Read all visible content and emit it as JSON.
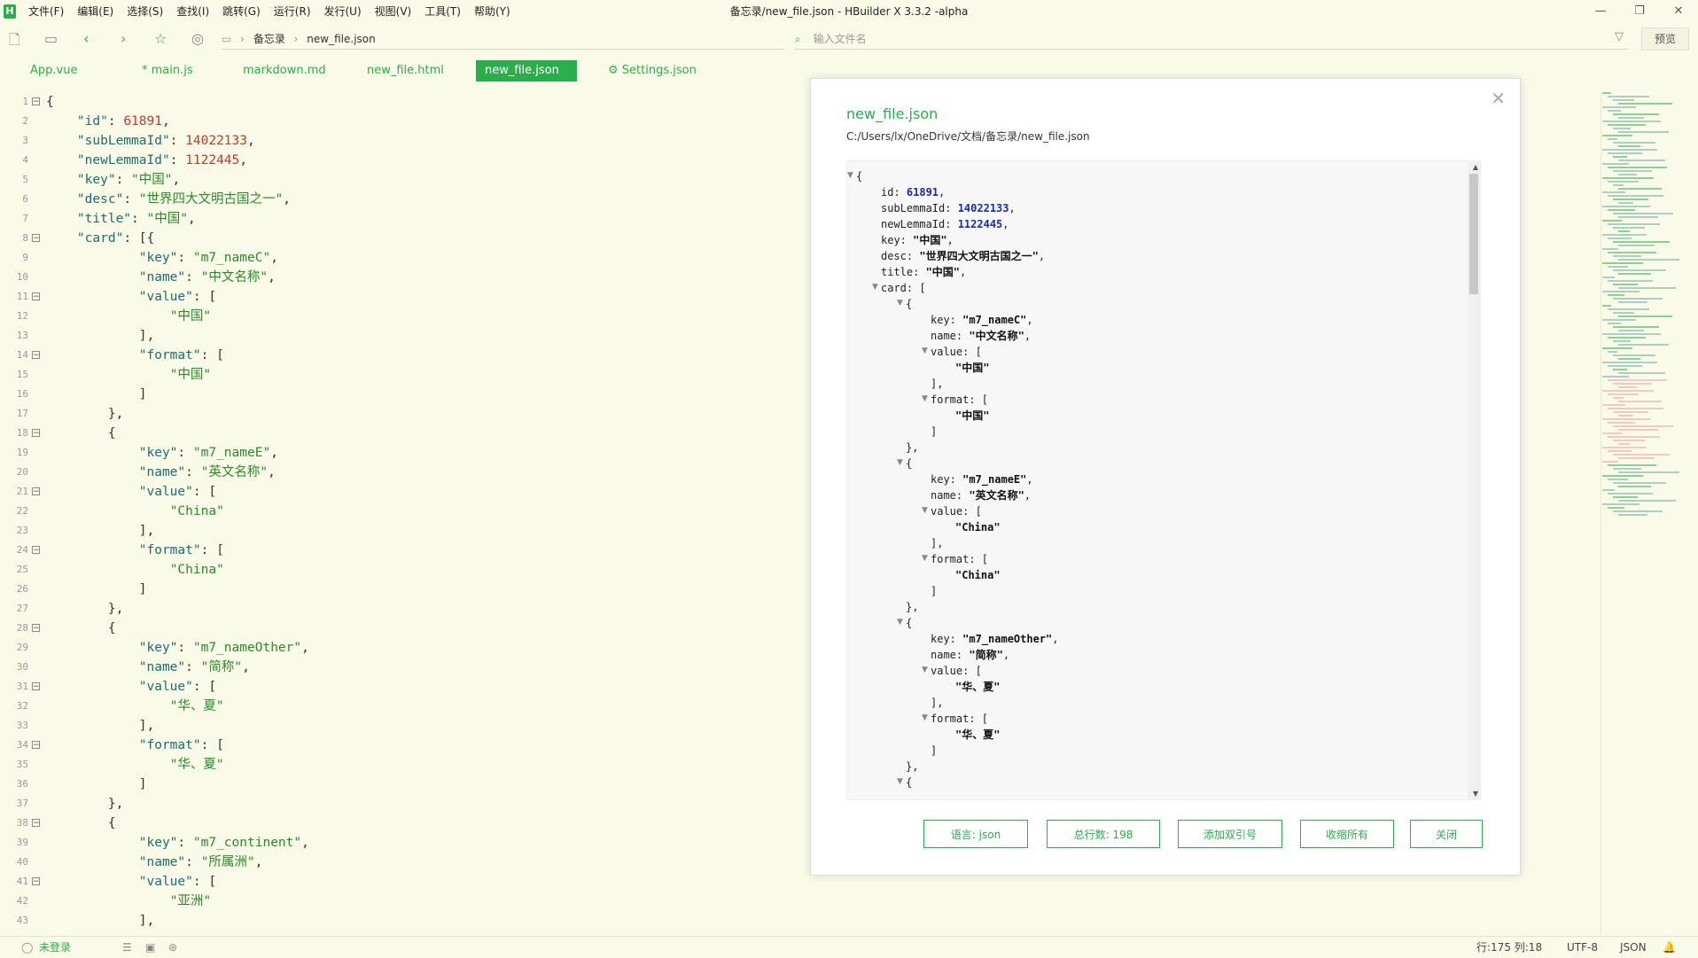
{
  "titlebar": {
    "menu": [
      "文件(F)",
      "编辑(E)",
      "选择(S)",
      "查找(I)",
      "跳转(G)",
      "运行(R)",
      "发行(U)",
      "视图(V)",
      "工具(T)",
      "帮助(Y)"
    ],
    "window_title": "备忘录/new_file.json - HBuilder X 3.3.2 -alpha"
  },
  "toolbar": {
    "breadcrumb": [
      "备忘录",
      "new_file.json"
    ],
    "file_search_placeholder": "输入文件名",
    "preview_label": "预览"
  },
  "tabs": [
    {
      "label": "App.vue",
      "active": false
    },
    {
      "label": "* main.js",
      "active": false
    },
    {
      "label": "markdown.md",
      "active": false
    },
    {
      "label": "new_file.html",
      "active": false
    },
    {
      "label": "new_file.json",
      "active": true
    },
    {
      "label": "⚙ Settings.json",
      "active": false
    }
  ],
  "editor_lines": [
    {
      "n": "1",
      "fold": true,
      "tokens": [
        [
          "p",
          "{"
        ]
      ]
    },
    {
      "n": "2",
      "tokens": [
        [
          "p",
          "    "
        ],
        [
          "k",
          "\"id\""
        ],
        [
          "p",
          ": "
        ],
        [
          "n",
          "61891"
        ],
        [
          "p",
          ","
        ]
      ]
    },
    {
      "n": "3",
      "tokens": [
        [
          "p",
          "    "
        ],
        [
          "k",
          "\"subLemmaId\""
        ],
        [
          "p",
          ": "
        ],
        [
          "n",
          "14022133"
        ],
        [
          "p",
          ","
        ]
      ]
    },
    {
      "n": "4",
      "tokens": [
        [
          "p",
          "    "
        ],
        [
          "k",
          "\"newLemmaId\""
        ],
        [
          "p",
          ": "
        ],
        [
          "n",
          "1122445"
        ],
        [
          "p",
          ","
        ]
      ]
    },
    {
      "n": "5",
      "tokens": [
        [
          "p",
          "    "
        ],
        [
          "k",
          "\"key\""
        ],
        [
          "p",
          ": "
        ],
        [
          "s",
          "\"中国\""
        ],
        [
          "p",
          ","
        ]
      ]
    },
    {
      "n": "6",
      "tokens": [
        [
          "p",
          "    "
        ],
        [
          "k",
          "\"desc\""
        ],
        [
          "p",
          ": "
        ],
        [
          "s",
          "\"世界四大文明古国之一\""
        ],
        [
          "p",
          ","
        ]
      ]
    },
    {
      "n": "7",
      "tokens": [
        [
          "p",
          "    "
        ],
        [
          "k",
          "\"title\""
        ],
        [
          "p",
          ": "
        ],
        [
          "s",
          "\"中国\""
        ],
        [
          "p",
          ","
        ]
      ]
    },
    {
      "n": "8",
      "fold": true,
      "tokens": [
        [
          "p",
          "    "
        ],
        [
          "k",
          "\"card\""
        ],
        [
          "p",
          ": [{"
        ]
      ]
    },
    {
      "n": "9",
      "tokens": [
        [
          "p",
          "            "
        ],
        [
          "k",
          "\"key\""
        ],
        [
          "p",
          ": "
        ],
        [
          "s",
          "\"m7_nameC\""
        ],
        [
          "p",
          ","
        ]
      ]
    },
    {
      "n": "10",
      "tokens": [
        [
          "p",
          "            "
        ],
        [
          "k",
          "\"name\""
        ],
        [
          "p",
          ": "
        ],
        [
          "s",
          "\"中文名称\""
        ],
        [
          "p",
          ","
        ]
      ]
    },
    {
      "n": "11",
      "fold": true,
      "tokens": [
        [
          "p",
          "            "
        ],
        [
          "k",
          "\"value\""
        ],
        [
          "p",
          ": ["
        ]
      ]
    },
    {
      "n": "12",
      "tokens": [
        [
          "p",
          "                "
        ],
        [
          "s",
          "\"中国\""
        ]
      ]
    },
    {
      "n": "13",
      "tokens": [
        [
          "p",
          "            ],"
        ]
      ]
    },
    {
      "n": "14",
      "fold": true,
      "tokens": [
        [
          "p",
          "            "
        ],
        [
          "k",
          "\"format\""
        ],
        [
          "p",
          ": ["
        ]
      ]
    },
    {
      "n": "15",
      "tokens": [
        [
          "p",
          "                "
        ],
        [
          "s",
          "\"中国\""
        ]
      ]
    },
    {
      "n": "16",
      "tokens": [
        [
          "p",
          "            ]"
        ]
      ]
    },
    {
      "n": "17",
      "tokens": [
        [
          "p",
          "        },"
        ]
      ]
    },
    {
      "n": "18",
      "fold": true,
      "tokens": [
        [
          "p",
          "        {"
        ]
      ]
    },
    {
      "n": "19",
      "tokens": [
        [
          "p",
          "            "
        ],
        [
          "k",
          "\"key\""
        ],
        [
          "p",
          ": "
        ],
        [
          "s",
          "\"m7_nameE\""
        ],
        [
          "p",
          ","
        ]
      ]
    },
    {
      "n": "20",
      "tokens": [
        [
          "p",
          "            "
        ],
        [
          "k",
          "\"name\""
        ],
        [
          "p",
          ": "
        ],
        [
          "s",
          "\"英文名称\""
        ],
        [
          "p",
          ","
        ]
      ]
    },
    {
      "n": "21",
      "fold": true,
      "tokens": [
        [
          "p",
          "            "
        ],
        [
          "k",
          "\"value\""
        ],
        [
          "p",
          ": ["
        ]
      ]
    },
    {
      "n": "22",
      "tokens": [
        [
          "p",
          "                "
        ],
        [
          "s",
          "\"China\""
        ]
      ]
    },
    {
      "n": "23",
      "tokens": [
        [
          "p",
          "            ],"
        ]
      ]
    },
    {
      "n": "24",
      "fold": true,
      "tokens": [
        [
          "p",
          "            "
        ],
        [
          "k",
          "\"format\""
        ],
        [
          "p",
          ": ["
        ]
      ]
    },
    {
      "n": "25",
      "tokens": [
        [
          "p",
          "                "
        ],
        [
          "s",
          "\"China\""
        ]
      ]
    },
    {
      "n": "26",
      "tokens": [
        [
          "p",
          "            ]"
        ]
      ]
    },
    {
      "n": "27",
      "tokens": [
        [
          "p",
          "        },"
        ]
      ]
    },
    {
      "n": "28",
      "fold": true,
      "tokens": [
        [
          "p",
          "        {"
        ]
      ]
    },
    {
      "n": "29",
      "tokens": [
        [
          "p",
          "            "
        ],
        [
          "k",
          "\"key\""
        ],
        [
          "p",
          ": "
        ],
        [
          "s",
          "\"m7_nameOther\""
        ],
        [
          "p",
          ","
        ]
      ]
    },
    {
      "n": "30",
      "tokens": [
        [
          "p",
          "            "
        ],
        [
          "k",
          "\"name\""
        ],
        [
          "p",
          ": "
        ],
        [
          "s",
          "\"简称\""
        ],
        [
          "p",
          ","
        ]
      ]
    },
    {
      "n": "31",
      "fold": true,
      "tokens": [
        [
          "p",
          "            "
        ],
        [
          "k",
          "\"value\""
        ],
        [
          "p",
          ": ["
        ]
      ]
    },
    {
      "n": "32",
      "tokens": [
        [
          "p",
          "                "
        ],
        [
          "s",
          "\"华、夏\""
        ]
      ]
    },
    {
      "n": "33",
      "tokens": [
        [
          "p",
          "            ],"
        ]
      ]
    },
    {
      "n": "34",
      "fold": true,
      "tokens": [
        [
          "p",
          "            "
        ],
        [
          "k",
          "\"format\""
        ],
        [
          "p",
          ": ["
        ]
      ]
    },
    {
      "n": "35",
      "tokens": [
        [
          "p",
          "                "
        ],
        [
          "s",
          "\"华、夏\""
        ]
      ]
    },
    {
      "n": "36",
      "tokens": [
        [
          "p",
          "            ]"
        ]
      ]
    },
    {
      "n": "37",
      "tokens": [
        [
          "p",
          "        },"
        ]
      ]
    },
    {
      "n": "38",
      "fold": true,
      "tokens": [
        [
          "p",
          "        {"
        ]
      ]
    },
    {
      "n": "39",
      "tokens": [
        [
          "p",
          "            "
        ],
        [
          "k",
          "\"key\""
        ],
        [
          "p",
          ": "
        ],
        [
          "s",
          "\"m7_continent\""
        ],
        [
          "p",
          ","
        ]
      ]
    },
    {
      "n": "40",
      "tokens": [
        [
          "p",
          "            "
        ],
        [
          "k",
          "\"name\""
        ],
        [
          "p",
          ": "
        ],
        [
          "s",
          "\"所属洲\""
        ],
        [
          "p",
          ","
        ]
      ]
    },
    {
      "n": "41",
      "fold": true,
      "tokens": [
        [
          "p",
          "            "
        ],
        [
          "k",
          "\"value\""
        ],
        [
          "p",
          ": ["
        ]
      ]
    },
    {
      "n": "42",
      "tokens": [
        [
          "p",
          "                "
        ],
        [
          "s",
          "\"亚洲\""
        ]
      ]
    },
    {
      "n": "43",
      "tokens": [
        [
          "p",
          "            ],"
        ]
      ]
    }
  ],
  "dialog": {
    "title": "new_file.json",
    "path": "C:/Users/lx/OneDrive/文档/备忘录/new_file.json",
    "tree_lines": [
      {
        "indent": 0,
        "tri": true,
        "tokens": [
          [
            "p",
            "{"
          ]
        ]
      },
      {
        "indent": 2,
        "tokens": [
          [
            "k",
            "id: "
          ],
          [
            "n",
            "61891"
          ],
          [
            "p",
            ","
          ]
        ]
      },
      {
        "indent": 2,
        "tokens": [
          [
            "k",
            "subLemmaId: "
          ],
          [
            "n",
            "14022133"
          ],
          [
            "p",
            ","
          ]
        ]
      },
      {
        "indent": 2,
        "tokens": [
          [
            "k",
            "newLemmaId: "
          ],
          [
            "n",
            "1122445"
          ],
          [
            "p",
            ","
          ]
        ]
      },
      {
        "indent": 2,
        "tokens": [
          [
            "k",
            "key: "
          ],
          [
            "s",
            "\"中国\""
          ],
          [
            "p",
            ","
          ]
        ]
      },
      {
        "indent": 2,
        "tokens": [
          [
            "k",
            "desc: "
          ],
          [
            "s",
            "\"世界四大文明古国之一\""
          ],
          [
            "p",
            ","
          ]
        ]
      },
      {
        "indent": 2,
        "tokens": [
          [
            "k",
            "title: "
          ],
          [
            "s",
            "\"中国\""
          ],
          [
            "p",
            ","
          ]
        ]
      },
      {
        "indent": 2,
        "tri": true,
        "tokens": [
          [
            "k",
            "card: "
          ],
          [
            "p",
            "["
          ]
        ]
      },
      {
        "indent": 4,
        "tri": true,
        "tokens": [
          [
            "p",
            "{"
          ]
        ]
      },
      {
        "indent": 6,
        "tokens": [
          [
            "k",
            "key: "
          ],
          [
            "s",
            "\"m7_nameC\""
          ],
          [
            "p",
            ","
          ]
        ]
      },
      {
        "indent": 6,
        "tokens": [
          [
            "k",
            "name: "
          ],
          [
            "s",
            "\"中文名称\""
          ],
          [
            "p",
            ","
          ]
        ]
      },
      {
        "indent": 6,
        "tri": true,
        "tokens": [
          [
            "k",
            "value: "
          ],
          [
            "p",
            "["
          ]
        ]
      },
      {
        "indent": 8,
        "tokens": [
          [
            "s",
            "\"中国\""
          ]
        ]
      },
      {
        "indent": 6,
        "tokens": [
          [
            "p",
            "],"
          ]
        ]
      },
      {
        "indent": 6,
        "tri": true,
        "tokens": [
          [
            "k",
            "format: "
          ],
          [
            "p",
            "["
          ]
        ]
      },
      {
        "indent": 8,
        "tokens": [
          [
            "s",
            "\"中国\""
          ]
        ]
      },
      {
        "indent": 6,
        "tokens": [
          [
            "p",
            "]"
          ]
        ]
      },
      {
        "indent": 4,
        "tokens": [
          [
            "p",
            "},"
          ]
        ]
      },
      {
        "indent": 4,
        "tri": true,
        "tokens": [
          [
            "p",
            "{"
          ]
        ]
      },
      {
        "indent": 6,
        "tokens": [
          [
            "k",
            "key: "
          ],
          [
            "s",
            "\"m7_nameE\""
          ],
          [
            "p",
            ","
          ]
        ]
      },
      {
        "indent": 6,
        "tokens": [
          [
            "k",
            "name: "
          ],
          [
            "s",
            "\"英文名称\""
          ],
          [
            "p",
            ","
          ]
        ]
      },
      {
        "indent": 6,
        "tri": true,
        "tokens": [
          [
            "k",
            "value: "
          ],
          [
            "p",
            "["
          ]
        ]
      },
      {
        "indent": 8,
        "tokens": [
          [
            "s",
            "\"China\""
          ]
        ]
      },
      {
        "indent": 6,
        "tokens": [
          [
            "p",
            "],"
          ]
        ]
      },
      {
        "indent": 6,
        "tri": true,
        "tokens": [
          [
            "k",
            "format: "
          ],
          [
            "p",
            "["
          ]
        ]
      },
      {
        "indent": 8,
        "tokens": [
          [
            "s",
            "\"China\""
          ]
        ]
      },
      {
        "indent": 6,
        "tokens": [
          [
            "p",
            "]"
          ]
        ]
      },
      {
        "indent": 4,
        "tokens": [
          [
            "p",
            "},"
          ]
        ]
      },
      {
        "indent": 4,
        "tri": true,
        "tokens": [
          [
            "p",
            "{"
          ]
        ]
      },
      {
        "indent": 6,
        "tokens": [
          [
            "k",
            "key: "
          ],
          [
            "s",
            "\"m7_nameOther\""
          ],
          [
            "p",
            ","
          ]
        ]
      },
      {
        "indent": 6,
        "tokens": [
          [
            "k",
            "name: "
          ],
          [
            "s",
            "\"简称\""
          ],
          [
            "p",
            ","
          ]
        ]
      },
      {
        "indent": 6,
        "tri": true,
        "tokens": [
          [
            "k",
            "value: "
          ],
          [
            "p",
            "["
          ]
        ]
      },
      {
        "indent": 8,
        "tokens": [
          [
            "s",
            "\"华、夏\""
          ]
        ]
      },
      {
        "indent": 6,
        "tokens": [
          [
            "p",
            "],"
          ]
        ]
      },
      {
        "indent": 6,
        "tri": true,
        "tokens": [
          [
            "k",
            "format: "
          ],
          [
            "p",
            "["
          ]
        ]
      },
      {
        "indent": 8,
        "tokens": [
          [
            "s",
            "\"华、夏\""
          ]
        ]
      },
      {
        "indent": 6,
        "tokens": [
          [
            "p",
            "]"
          ]
        ]
      },
      {
        "indent": 4,
        "tokens": [
          [
            "p",
            "},"
          ]
        ]
      },
      {
        "indent": 4,
        "tri": true,
        "tokens": [
          [
            "p",
            "{"
          ]
        ]
      }
    ],
    "buttons": [
      "语言: json",
      "总行数: 198",
      "添加双引号",
      "收缩所有",
      "关闭"
    ]
  },
  "statusbar": {
    "login": "未登录",
    "cursor": "行:175  列:18",
    "encoding": "UTF-8",
    "language": "JSON"
  },
  "colors": {
    "accent": "#2bad4b",
    "background": "#fafae8"
  }
}
